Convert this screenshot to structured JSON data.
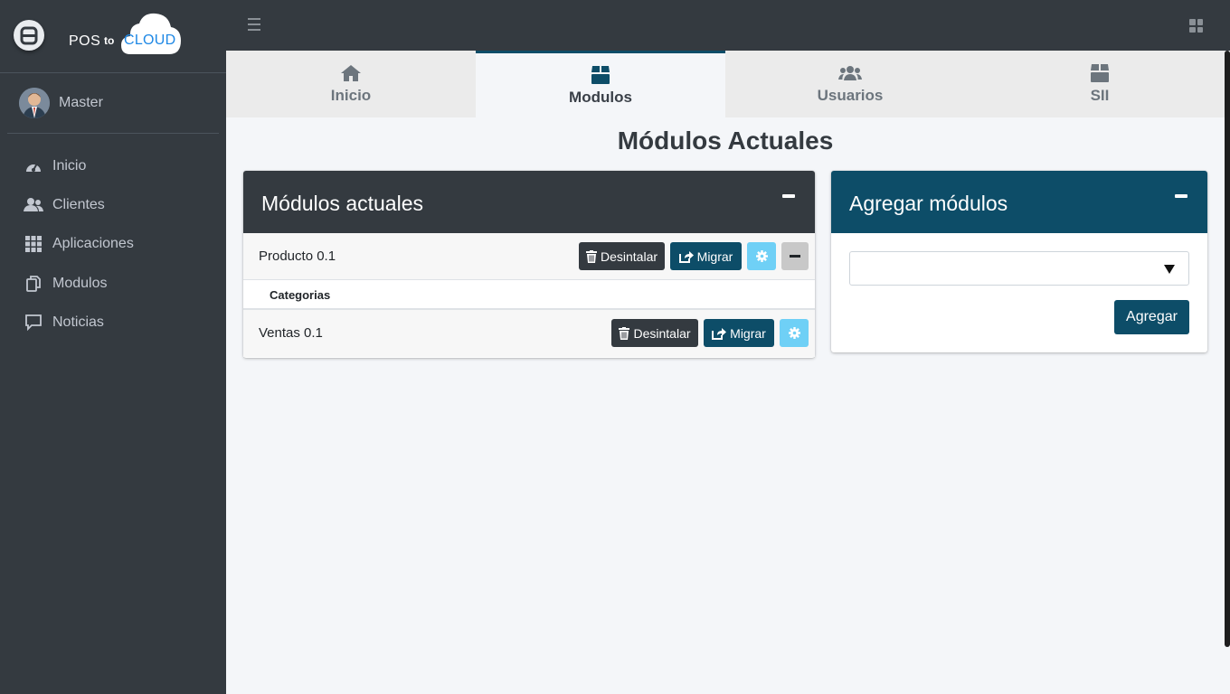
{
  "brand": {
    "pos": "POS",
    "to": "to",
    "cloud": "CLOUD"
  },
  "user": {
    "name": "Master"
  },
  "sidebar": {
    "items": [
      {
        "label": "Inicio",
        "icon": "tachometer-icon"
      },
      {
        "label": "Clientes",
        "icon": "users-icon"
      },
      {
        "label": "Aplicaciones",
        "icon": "th-icon"
      },
      {
        "label": "Modulos",
        "icon": "copy-icon"
      },
      {
        "label": "Noticias",
        "icon": "comment-icon"
      }
    ]
  },
  "tabs": [
    {
      "label": "Inicio",
      "icon": "home-icon",
      "active": false
    },
    {
      "label": "Modulos",
      "icon": "box-icon",
      "active": true
    },
    {
      "label": "Usuarios",
      "icon": "users-icon",
      "active": false
    },
    {
      "label": "SII",
      "icon": "box-icon",
      "active": false
    }
  ],
  "page": {
    "title": "Módulos Actuales"
  },
  "current_modules": {
    "title": "Módulos actuales",
    "modules": [
      {
        "name": "Producto 0.1",
        "submodules": [
          "Categorias"
        ]
      },
      {
        "name": "Ventas 0.1",
        "submodules": []
      }
    ],
    "uninstall_label": "Desintalar",
    "migrate_label": "Migrar"
  },
  "add_modules": {
    "title": "Agregar módulos",
    "select_value": "",
    "button_label": "Agregar"
  },
  "colors": {
    "sidebar": "#343a40",
    "primary": "#0d4d68",
    "info": "#6fd0f6",
    "background": "#f4f6f9"
  }
}
